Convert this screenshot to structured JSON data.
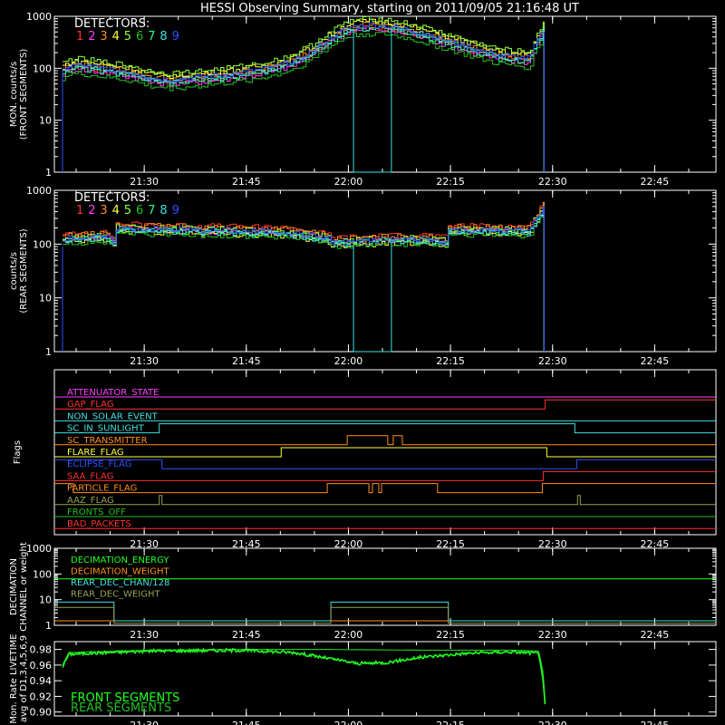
{
  "title": "HESSI Observing Summary, starting on 2011/09/05 21:16:48 UT",
  "time_ticks": [
    "21:30",
    "21:45",
    "22:00",
    "22:15",
    "22:30",
    "22:45"
  ],
  "colors": {
    "det1": "#ff3030",
    "det2": "#ff40ff",
    "det3": "#ff8c1a",
    "det4": "#ffff40",
    "det5": "#90ff40",
    "det6": "#20c020",
    "det7": "#20ff90",
    "det8": "#40e0e0",
    "det9": "#3050ff",
    "white": "#ffffff"
  },
  "chart_data": [
    {
      "type": "line",
      "name": "front",
      "ylabel_lines": [
        "MON. counts/s",
        "(FRONT SEGMENTS)"
      ],
      "legend_title": "DETECTORS:",
      "legend_numbers": [
        "1",
        "2",
        "3",
        "4",
        "5",
        "6",
        "7",
        "8",
        "9"
      ],
      "yscale": "log",
      "ylim": [
        1,
        1000
      ],
      "ytick_labels": [
        "1",
        "10",
        "100",
        "1000"
      ],
      "xlim_minutes": [
        0,
        58
      ],
      "x_minutes": [
        0,
        1,
        2,
        4,
        6,
        8,
        10,
        12,
        14,
        16,
        18,
        20,
        22,
        24,
        26,
        28,
        30,
        32,
        34,
        36,
        38,
        40,
        42,
        44,
        46,
        48,
        50,
        52,
        53.5
      ],
      "base": [
        80,
        100,
        105,
        95,
        85,
        75,
        60,
        55,
        58,
        62,
        68,
        75,
        85,
        100,
        130,
        200,
        350,
        560,
        620,
        600,
        520,
        430,
        340,
        270,
        210,
        170,
        150,
        140,
        480
      ],
      "factors": [
        1.0,
        0.9,
        1.15,
        1.3,
        1.45,
        0.75,
        0.95,
        1.05,
        1.1
      ],
      "cyan_drop": [
        [
          32.3,
          1
        ],
        [
          36.5,
          1
        ]
      ],
      "end_minute": 53.6
    },
    {
      "type": "line",
      "name": "rear",
      "ylabel_lines": [
        "counts/s",
        "(REAR SEGMENTS)"
      ],
      "legend_title": "DETECTORS:",
      "legend_numbers": [
        "1",
        "2",
        "3",
        "4",
        "5",
        "6",
        "7",
        "8",
        "9"
      ],
      "yscale": "log",
      "ylim": [
        1,
        1000
      ],
      "ytick_labels": [
        "1",
        "10",
        "100",
        "1000"
      ],
      "xlim_minutes": [
        0,
        58
      ],
      "x_minutes": [
        0,
        5,
        5.9,
        6,
        15,
        25,
        29.9,
        30,
        40,
        42.9,
        43,
        52,
        53.5
      ],
      "base": [
        120,
        130,
        105,
        190,
        175,
        160,
        120,
        105,
        120,
        105,
        175,
        170,
        450
      ],
      "factors": [
        1.25,
        1.0,
        1.2,
        0.9,
        1.1,
        0.85,
        1.0,
        0.95,
        1.05
      ],
      "cyan_drop": [
        [
          32.3,
          1
        ],
        [
          36.5,
          1
        ]
      ],
      "end_minute": 53.6
    },
    {
      "type": "step",
      "name": "flags",
      "ylabel_lines": [
        "Flags"
      ],
      "flags": [
        {
          "label": "ATTENUATOR_STATE",
          "color": "#ff40ff",
          "steps": [
            [
              0,
              0
            ]
          ]
        },
        {
          "label": "GAP_FLAG",
          "color": "#ff3030",
          "steps": [
            [
              0,
              0
            ],
            [
              53.7,
              1
            ]
          ]
        },
        {
          "label": "NON_SOLAR_EVENT",
          "color": "#40e0e0",
          "steps": [
            [
              0,
              0
            ]
          ]
        },
        {
          "label": "SC_IN_SUNLIGHT",
          "color": "#40e0e0",
          "steps": [
            [
              0,
              0
            ],
            [
              11,
              1
            ],
            [
              57,
              0
            ]
          ]
        },
        {
          "label": "SC_TRANSMITTER",
          "color": "#ff8c1a",
          "steps": [
            [
              0,
              0
            ],
            [
              31.8,
              1
            ],
            [
              36.3,
              0
            ],
            [
              36.9,
              1
            ],
            [
              37.9,
              0
            ]
          ]
        },
        {
          "label": "FLARE_FLAG",
          "color": "#ffff40",
          "steps": [
            [
              0,
              0
            ],
            [
              24.5,
              1
            ],
            [
              53.9,
              0
            ]
          ]
        },
        {
          "label": "ECLIPSE_FLAG",
          "color": "#3050ff",
          "steps": [
            [
              0,
              1
            ],
            [
              11.3,
              0
            ],
            [
              57.2,
              1
            ]
          ]
        },
        {
          "label": "SAA_FLAG",
          "color": "#ff3030",
          "steps": [
            [
              0,
              0
            ],
            [
              53.5,
              1
            ]
          ]
        },
        {
          "label": "PARTICLE_FLAG",
          "color": "#ff8c1a",
          "steps": [
            [
              0,
              1
            ],
            [
              1.5,
              0
            ],
            [
              29.6,
              1
            ],
            [
              34.2,
              0
            ],
            [
              34.6,
              1
            ],
            [
              35.3,
              0
            ],
            [
              35.6,
              1
            ],
            [
              41.8,
              0
            ],
            [
              53.4,
              1
            ]
          ]
        },
        {
          "label": "AAZ_FLAG",
          "color": "#9aa050",
          "steps": [
            [
              0,
              0
            ],
            [
              11,
              1
            ],
            [
              11.3,
              0
            ],
            [
              57.3,
              1
            ],
            [
              57.6,
              0
            ]
          ]
        },
        {
          "label": "FRONTS_OFF",
          "color": "#20c020",
          "steps": [
            [
              0,
              0
            ]
          ]
        },
        {
          "label": "BAD_PACKETS",
          "color": "#ff3030",
          "steps": [
            [
              0,
              0
            ]
          ]
        }
      ]
    },
    {
      "type": "step",
      "name": "decimation",
      "ylabel_lines": [
        "DECIMATION",
        "CHANNEL or weight"
      ],
      "yscale": "log",
      "ylim": [
        1,
        1000
      ],
      "ytick_labels": [
        "1",
        "10",
        "100",
        "1000"
      ],
      "legend": [
        {
          "label": "DECIMATION_ENERGY",
          "color": "#20ff20"
        },
        {
          "label": "DECIMATION_WEIGHT",
          "color": "#ff8c1a"
        },
        {
          "label": "REAR_DEC_CHAN/128",
          "color": "#40e0e0"
        },
        {
          "label": "REAR_DEC_WEIGHT",
          "color": "#9aa050"
        }
      ],
      "series": [
        {
          "name": "DECIMATION_ENERGY",
          "color": "#20ff20",
          "steps": [
            [
              0,
              64
            ]
          ]
        },
        {
          "name": "DECIMATION_WEIGHT",
          "color": "#ff8c1a",
          "steps": [
            [
              0,
              1.5
            ]
          ]
        },
        {
          "name": "REAR_DEC_CHAN/128",
          "color": "#40e0e0",
          "steps": [
            [
              0,
              8
            ],
            [
              6,
              1.5
            ],
            [
              30,
              8
            ],
            [
              43,
              1.5
            ]
          ]
        },
        {
          "name": "REAR_DEC_WEIGHT",
          "color": "#9aa050",
          "steps": [
            [
              0,
              5
            ],
            [
              6,
              1.2
            ],
            [
              30,
              5
            ],
            [
              43,
              1.2
            ]
          ]
        }
      ]
    },
    {
      "type": "line",
      "name": "livetime",
      "ylabel_lines": [
        "Mon. Rate LIVETIME",
        "avg of D1,3,4,5,6,9"
      ],
      "ylim": [
        0.895,
        0.99
      ],
      "ytick_labels": [
        "0.90",
        "0.92",
        "0.94",
        "0.96",
        "0.98"
      ],
      "ytick_values": [
        0.9,
        0.92,
        0.94,
        0.96,
        0.98
      ],
      "legend": [
        {
          "label": "FRONT SEGMENTS",
          "color": "#20ff20"
        },
        {
          "label": "REAR SEGMENTS",
          "color": "#20c020"
        }
      ],
      "series": [
        {
          "name": "FRONT SEGMENTS",
          "color": "#20ff20",
          "x": [
            0.3,
            1,
            5,
            10,
            20,
            26,
            30,
            33,
            36,
            40,
            45,
            50,
            53,
            53.5,
            53.8
          ],
          "y": [
            0.958,
            0.974,
            0.976,
            0.978,
            0.979,
            0.976,
            0.968,
            0.962,
            0.963,
            0.97,
            0.975,
            0.977,
            0.975,
            0.94,
            0.895
          ]
        },
        {
          "name": "REAR SEGMENTS",
          "color": "#20c020",
          "x": [
            0.3,
            1,
            10,
            20,
            30,
            40,
            50,
            53,
            53.5,
            53.8
          ],
          "y": [
            0.96,
            0.976,
            0.979,
            0.98,
            0.98,
            0.979,
            0.979,
            0.978,
            0.95,
            0.895
          ]
        }
      ]
    }
  ]
}
